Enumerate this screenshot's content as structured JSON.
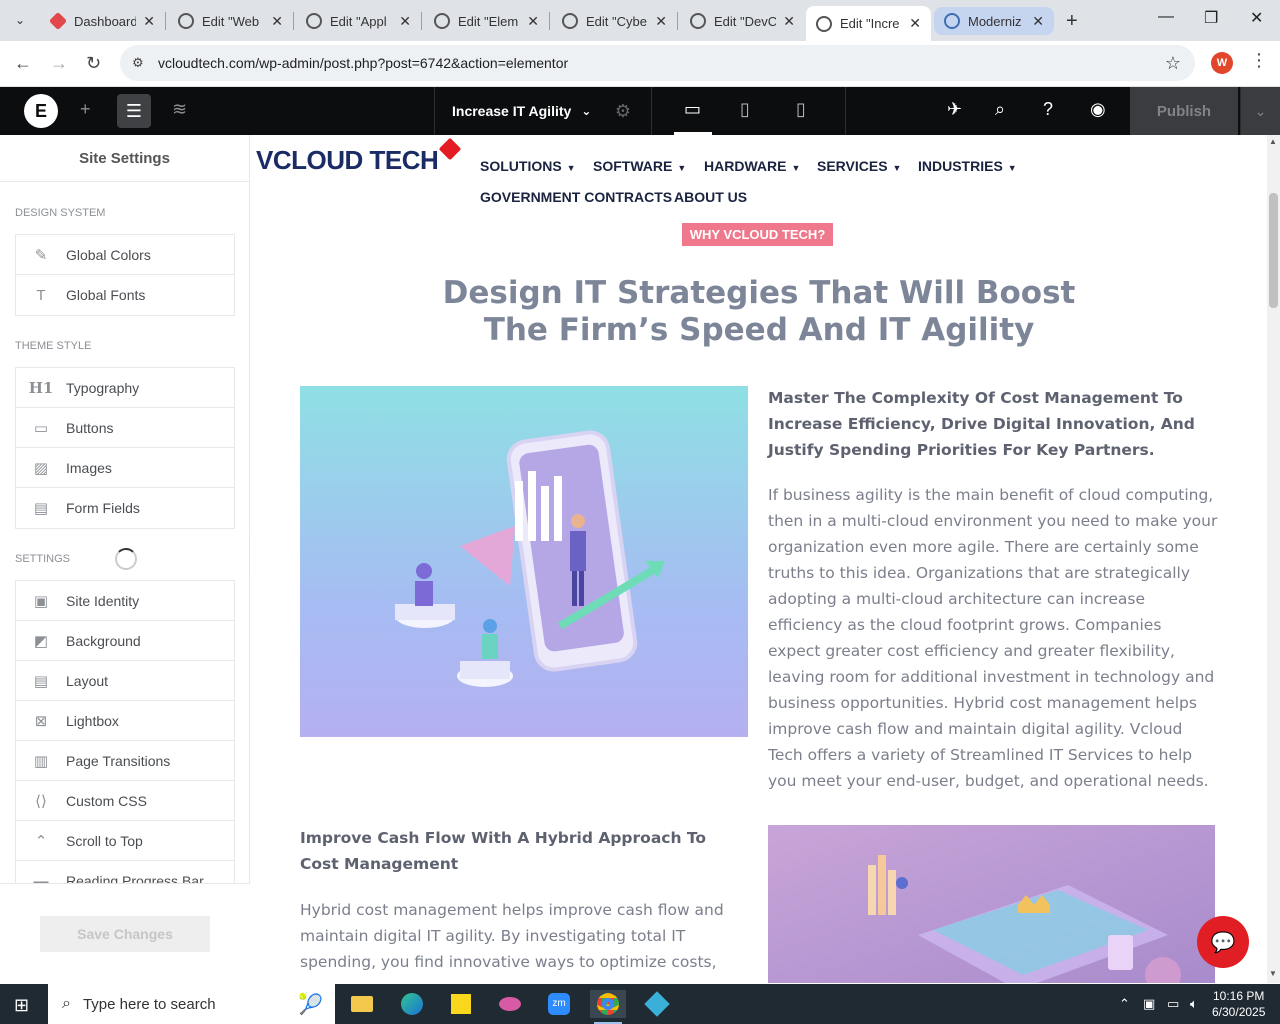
{
  "browser": {
    "tabs": [
      {
        "title": "Dashboard",
        "favicon": "elementor-red"
      },
      {
        "title": "Edit \"Web",
        "favicon": "wordpress"
      },
      {
        "title": "Edit \"Appl",
        "favicon": "wordpress"
      },
      {
        "title": "Edit \"Elem",
        "favicon": "wordpress"
      },
      {
        "title": "Edit \"Cybe",
        "favicon": "wordpress"
      },
      {
        "title": "Edit \"DevC",
        "favicon": "wordpress"
      },
      {
        "title": "Edit \"Incre",
        "favicon": "wordpress",
        "active": true
      },
      {
        "title": "Moderniz",
        "favicon": "edge-web",
        "highlighted": true
      }
    ],
    "url": "vcloudtech.com/wp-admin/post.php?post=6742&action=elementor",
    "profile_initial": "W"
  },
  "elementor": {
    "page_title": "Increase IT Agility",
    "publish_label": "Publish"
  },
  "sidebar": {
    "title": "Site Settings",
    "design_system_label": "DESIGN SYSTEM",
    "design_system": [
      {
        "label": "Global Colors",
        "icon": "brush-icon"
      },
      {
        "label": "Global Fonts",
        "icon": "font-icon"
      }
    ],
    "theme_style_label": "THEME STYLE",
    "theme_style": [
      {
        "label": "Typography",
        "icon": "h1-icon"
      },
      {
        "label": "Buttons",
        "icon": "button-icon"
      },
      {
        "label": "Images",
        "icon": "image-icon"
      },
      {
        "label": "Form Fields",
        "icon": "form-icon"
      }
    ],
    "settings_label": "SETTINGS",
    "settings": [
      {
        "label": "Site Identity",
        "icon": "id-icon"
      },
      {
        "label": "Background",
        "icon": "background-icon"
      },
      {
        "label": "Layout",
        "icon": "layout-icon"
      },
      {
        "label": "Lightbox",
        "icon": "lightbox-icon"
      },
      {
        "label": "Page Transitions",
        "icon": "transitions-icon"
      },
      {
        "label": "Custom CSS",
        "icon": "code-icon"
      },
      {
        "label": "Scroll to Top",
        "icon": "scroll-top-icon"
      },
      {
        "label": "Reading Progress Bar",
        "icon": "progress-icon"
      }
    ],
    "save_label": "Save Changes"
  },
  "site": {
    "logo_text": "VCLOUD TECH",
    "nav": [
      {
        "label": "SOLUTIONS",
        "dropdown": true
      },
      {
        "label": "SOFTWARE",
        "dropdown": true
      },
      {
        "label": "HARDWARE",
        "dropdown": true
      },
      {
        "label": "SERVICES",
        "dropdown": true
      },
      {
        "label": "INDUSTRIES",
        "dropdown": true
      },
      {
        "label": "GOVERNMENT CONTRACTS",
        "dropdown": false
      },
      {
        "label": "ABOUT US",
        "dropdown": false
      }
    ],
    "badge": "WHY VCLOUD TECH?",
    "headline_line1": "Design IT Strategies That Will Boost",
    "headline_line2": "The Firm’s Speed And IT Agility",
    "section1_heading": "Master The Complexity Of Cost Management To Increase Efficiency, Drive Digital Innovation, And Justify Spending Priorities For Key Partners.",
    "section1_body": "If business agility is the main benefit of cloud computing, then in a multi-cloud environment you need to make your organization even more agile. There are certainly some truths to this idea. Organizations that are strategically adopting a multi-cloud architecture can increase efficiency as the cloud footprint grows. Companies expect greater cost efficiency and greater flexibility, leaving room for additional investment in technology and business opportunities. Hybrid cost management helps improve cash flow and maintain digital agility. Vcloud Tech offers a variety of Streamlined IT Services to help you meet your end-user, budget, and operational needs.",
    "section2_heading": "Improve Cash Flow With A Hybrid Approach To Cost Management",
    "section2_body": "Hybrid cost management helps improve cash flow and maintain digital IT agility. By investigating total IT spending, you find innovative ways to optimize costs,"
  },
  "taskbar": {
    "search_placeholder": "Type here to search",
    "time": "10:16 PM",
    "date": "6/30/2025"
  }
}
